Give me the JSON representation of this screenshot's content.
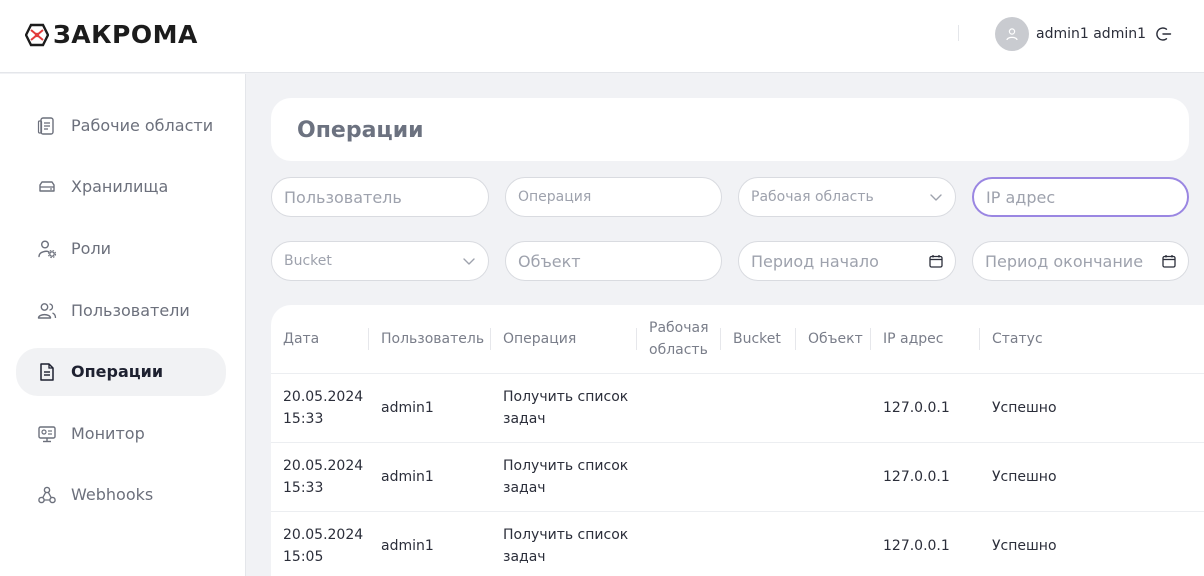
{
  "brand": {
    "name": "ЗАКРОМА"
  },
  "user": {
    "name": "admin1 admin1"
  },
  "sidebar": {
    "items": [
      {
        "label": "Рабочие области",
        "icon": "workspaces-icon"
      },
      {
        "label": "Хранилища",
        "icon": "storage-icon"
      },
      {
        "label": "Роли",
        "icon": "roles-icon"
      },
      {
        "label": "Пользователи",
        "icon": "users-icon"
      },
      {
        "label": "Операции",
        "icon": "operations-icon",
        "active": true
      },
      {
        "label": "Монитор",
        "icon": "monitor-icon"
      },
      {
        "label": "Webhooks",
        "icon": "webhooks-icon"
      }
    ]
  },
  "page": {
    "title": "Операции"
  },
  "filters": {
    "user": {
      "placeholder": "Пользователь"
    },
    "operation": {
      "placeholder": "Операция"
    },
    "workspace": {
      "placeholder": "Рабочая область"
    },
    "ip": {
      "placeholder": "IP адрес"
    },
    "bucket": {
      "placeholder": "Bucket"
    },
    "object": {
      "placeholder": "Объект"
    },
    "period_start": {
      "placeholder": "Период начало"
    },
    "period_end": {
      "placeholder": "Период окончание"
    }
  },
  "table": {
    "columns": {
      "date": "Дата",
      "user": "Пользователь",
      "operation": "Операция",
      "workspace_1": "Рабочая",
      "workspace_2": "область",
      "bucket": "Bucket",
      "object": "Объект",
      "ip": "IP адрес",
      "status": "Статус"
    },
    "rows": [
      {
        "date": "20.05.2024",
        "time": "15:33",
        "user": "admin1",
        "op_1": "Получить список",
        "op_2": "задач",
        "workspace": "",
        "bucket": "",
        "object": "",
        "ip": "127.0.0.1",
        "status": "Успешно"
      },
      {
        "date": "20.05.2024",
        "time": "15:33",
        "user": "admin1",
        "op_1": "Получить список",
        "op_2": "задач",
        "workspace": "",
        "bucket": "",
        "object": "",
        "ip": "127.0.0.1",
        "status": "Успешно"
      },
      {
        "date": "20.05.2024",
        "time": "15:05",
        "user": "admin1",
        "op_1": "Получить список",
        "op_2": "задач",
        "workspace": "",
        "bucket": "",
        "object": "",
        "ip": "127.0.0.1",
        "status": "Успешно"
      }
    ]
  }
}
